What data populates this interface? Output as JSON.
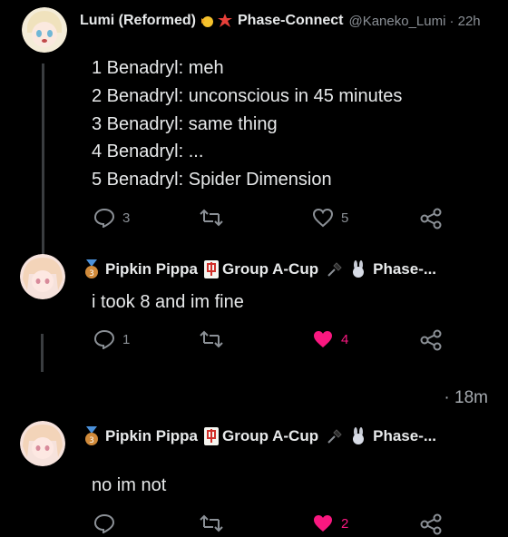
{
  "tweet1": {
    "author_name": "Lumi (Reformed)",
    "org": "Phase-Connect",
    "handle": "@Kaneko_Lumi",
    "time": "· 22h",
    "lines": [
      "1 Benadryl: meh",
      "2 Benadryl: unconscious in 45 minutes",
      "3 Benadryl: same thing",
      "4 Benadryl: ...",
      "5 Benadryl: Spider Dimension"
    ],
    "reply_count": "3",
    "like_count": "5"
  },
  "reply1": {
    "author_name": "Pipkin Pippa",
    "group": "Group A-Cup",
    "org": "Phase-...",
    "text": "i took 8 and im fine",
    "reply_count": "1",
    "like_count": "4"
  },
  "timestamp_gap": "· 18m",
  "reply2": {
    "author_name": "Pipkin Pippa",
    "group": "Group A-Cup",
    "org": "Phase-...",
    "text": "no im not",
    "like_count": "2"
  },
  "colors": {
    "background": "#000000",
    "text": "#e7e9ea",
    "muted": "#8b9096",
    "liked": "#f91880"
  },
  "icons": [
    "reply-icon",
    "retweet-icon",
    "like-icon",
    "share-icon",
    "bronze-medal-icon",
    "mahjong-tile-icon",
    "plug-icon",
    "bunny-icon",
    "sparkle-icon"
  ]
}
